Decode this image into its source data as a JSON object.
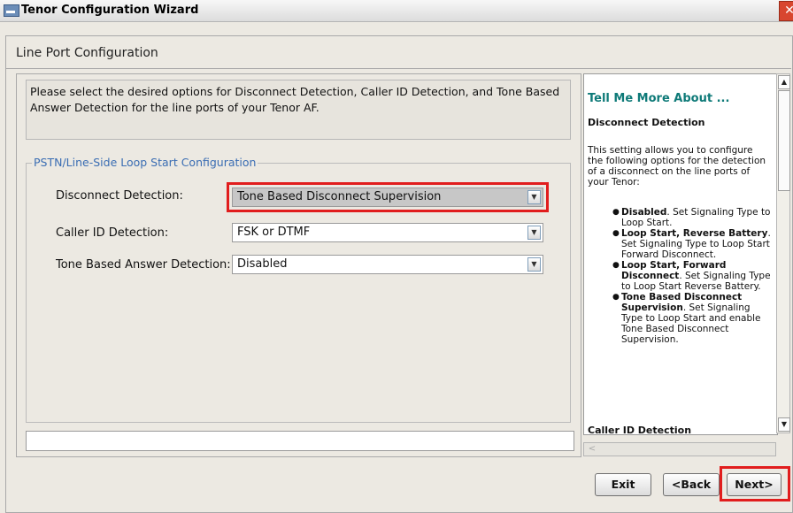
{
  "window": {
    "title": "Tenor Configuration Wizard",
    "close_label": "✕"
  },
  "page": {
    "title": "Line Port Configuration"
  },
  "instructions": "Please select the desired options for Disconnect Detection,  Caller ID Detection, and Tone Based Answer Detection for the line ports of your Tenor AF.",
  "group": {
    "legend": "PSTN/Line-Side Loop Start Configuration",
    "fields": [
      {
        "label": "Disconnect Detection:",
        "value": "Tone Based Disconnect Supervision"
      },
      {
        "label": "Caller ID Detection:",
        "value": "FSK or DTMF"
      },
      {
        "label": "Tone Based Answer Detection:",
        "value": "Disabled"
      }
    ]
  },
  "status": {
    "value": ""
  },
  "help": {
    "heading": "Tell Me More About ...",
    "subheading": "Disconnect Detection",
    "paragraph": "This setting allows you to configure the following options for the detection of a disconnect on the line ports of your Tenor:",
    "items": [
      {
        "bold": "Disabled",
        "text": ". Set Signaling Type to Loop Start."
      },
      {
        "bold": "Loop Start, Reverse Battery",
        "text": ". Set Signaling Type to Loop Start Forward Disconnect."
      },
      {
        "bold": "Loop Start, Forward Disconnect",
        "text": ". Set Signaling Type to Loop Start Reverse Battery."
      },
      {
        "bold": "Tone Based Disconnect Supervision",
        "text": ". Set Signaling Type to Loop Start and enable Tone Based Disconnect Supervision."
      }
    ],
    "next_section": "Caller ID Detection"
  },
  "buttons": {
    "exit": "Exit",
    "back": "<Back",
    "next": "Next>"
  },
  "colors": {
    "highlight": "#e11d1d",
    "help_heading": "#0e7a78",
    "legend": "#3a6db3"
  },
  "icons": {
    "window": "app-window-icon",
    "select_arrow": "chevron-down-icon"
  }
}
